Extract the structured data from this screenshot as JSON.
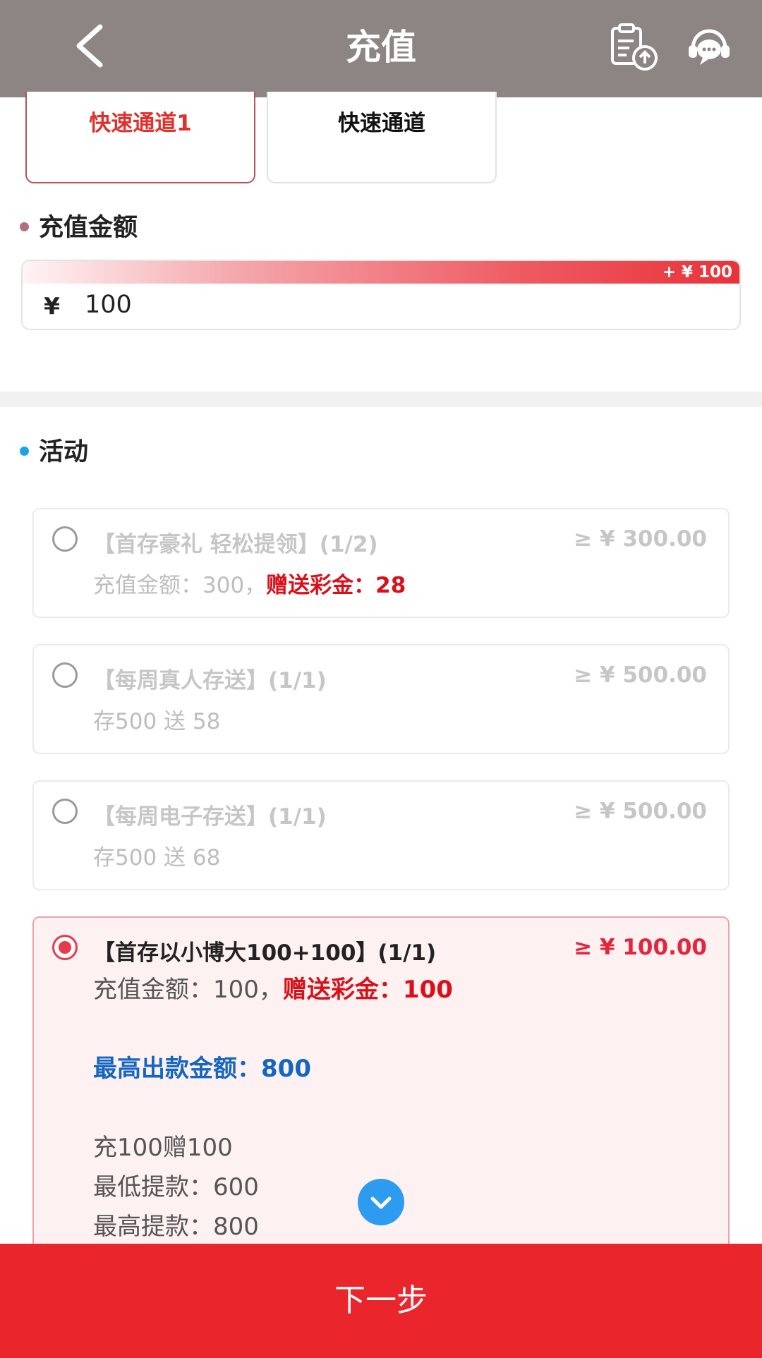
{
  "header": {
    "title": "充值",
    "icons": {
      "back": "chevron-left-icon",
      "upload": "clipboard-upload-icon",
      "support": "customer-service-icon"
    }
  },
  "channels": [
    {
      "label": "快速通道1",
      "selected": true
    },
    {
      "label": "快速通道",
      "selected": false
    }
  ],
  "amount_section": {
    "title": "充值金额",
    "bonus_tag": "+ ¥ 100",
    "currency": "¥",
    "value": "100"
  },
  "activity_section": {
    "title": "活动",
    "items": [
      {
        "name": "【首存豪礼 轻松提领】(1/2)",
        "min": "≥ ¥ 300.00",
        "desc": "充值金额：300，",
        "desc_highlight": "赠送彩金：28",
        "selected": false
      },
      {
        "name": "【每周真人存送】(1/1)",
        "min": "≥ ¥ 500.00",
        "desc": "存500 送 58",
        "selected": false
      },
      {
        "name": "【每周电子存送】(1/1)",
        "min": "≥ ¥ 500.00",
        "desc": "存500 送 68",
        "selected": false
      },
      {
        "name": "【首存以小博大100+100】(1/1)",
        "min": "≥ ¥ 100.00",
        "desc": "充值金额：100，",
        "desc_highlight": "赠送彩金：100",
        "max_withdraw": "最高出款金额：800",
        "details": [
          "充100赠100",
          "最低提款：600",
          "最高提款：800"
        ],
        "selected": true
      }
    ]
  },
  "expand_icon": "chevron-down-icon",
  "next_button": "下一步",
  "colors": {
    "header": "#8d8484",
    "accent": "#ea252c",
    "blue": "#1566c0"
  }
}
